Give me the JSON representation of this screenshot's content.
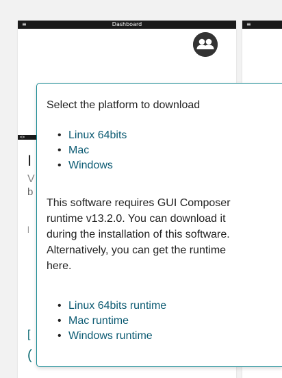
{
  "dashboard_card": {
    "menu_glyph": "≡",
    "title": "Dashboard",
    "avatar_icon": "users-group-icon"
  },
  "side_card": {
    "menu_glyph": "≡"
  },
  "underlay": {
    "bar_glyph": "<>",
    "chars": [
      "I",
      "V",
      "b",
      "l",
      "[",
      "("
    ]
  },
  "popup": {
    "heading": "Select the platform to download",
    "platforms": [
      {
        "label": "Linux 64bits"
      },
      {
        "label": "Mac"
      },
      {
        "label": "Windows"
      }
    ],
    "note_lines": [
      "This software requires GUI Composer",
      "runtime v13.2.0. You can download it",
      "during the installation of this software.",
      "Alternatively, you can get the runtime",
      "here."
    ],
    "runtimes": [
      {
        "label": "Linux 64bits runtime"
      },
      {
        "label": "Mac runtime"
      },
      {
        "label": "Windows runtime"
      }
    ]
  },
  "colors": {
    "popup_border": "#1a8a93",
    "link": "#0b5a72",
    "card_bar": "#1a1a1a",
    "background": "#f2f2f2"
  }
}
